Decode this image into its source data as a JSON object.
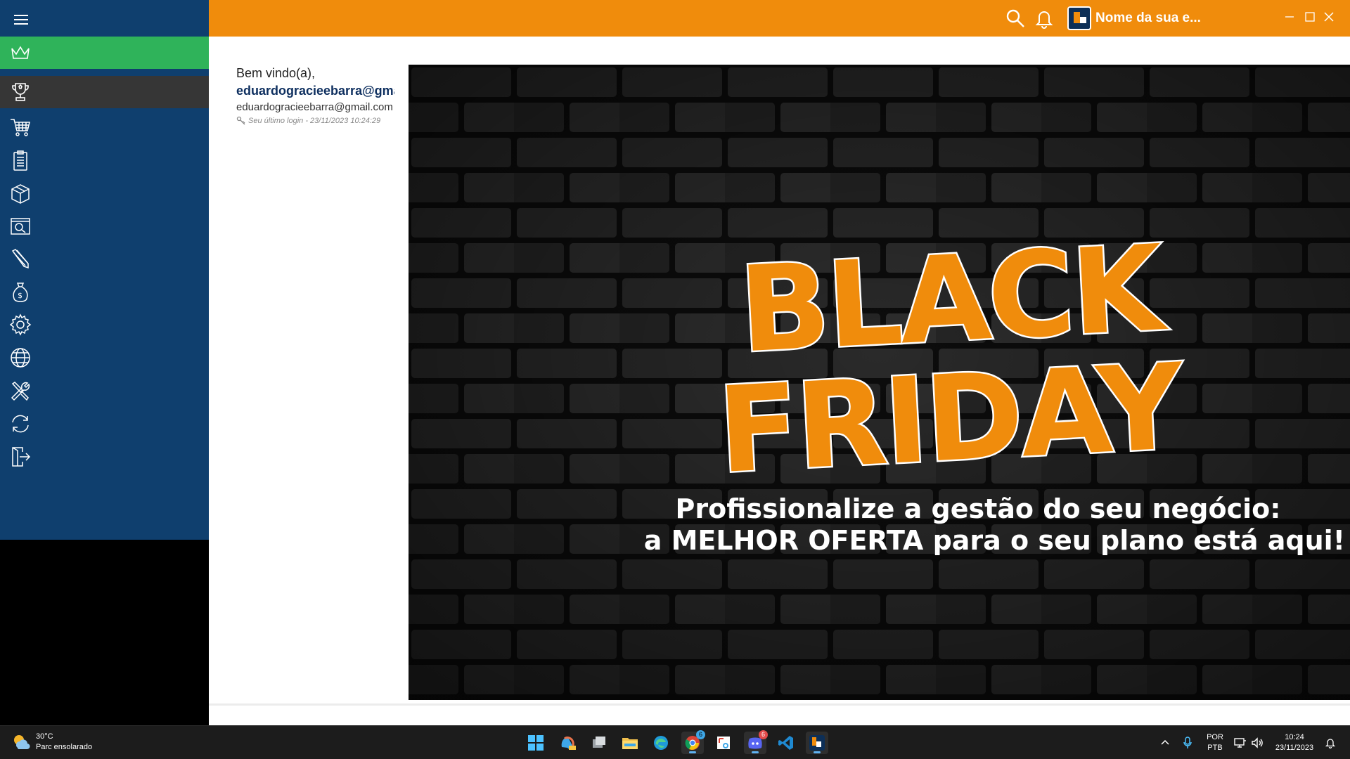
{
  "header": {
    "company_name": "Nome da sua e...",
    "accent_color": "#f08c0c",
    "icons": [
      "search-icon",
      "bell-icon"
    ]
  },
  "sidebar": {
    "color": "#0f3f6e",
    "active_color": "#2fb35a",
    "items": [
      {
        "icon": "crown-icon",
        "state": "active"
      },
      {
        "icon": "trophy-icon",
        "state": "hover"
      },
      {
        "icon": "cart-icon"
      },
      {
        "icon": "clipboard-icon"
      },
      {
        "icon": "box-icon"
      },
      {
        "icon": "screen-search-icon"
      },
      {
        "icon": "pencil-icon"
      },
      {
        "icon": "money-bag-icon"
      },
      {
        "icon": "gear-icon"
      },
      {
        "icon": "globe-icon"
      },
      {
        "icon": "tools-icon"
      },
      {
        "icon": "sync-icon"
      },
      {
        "icon": "logout-icon"
      }
    ]
  },
  "welcome": {
    "greeting": "Bem vindo(a),",
    "username": "eduardogracieebarra@gmai",
    "email": "eduardogracieebarra@gmail.com",
    "last_login": "Seu último login - 23/11/2023 10:24:29"
  },
  "banner": {
    "line1": "BLACK",
    "line2": "FRIDAY",
    "subtitle1": "Profissionalize a gestão do seu negócio:",
    "subtitle2_prefix": "a ",
    "subtitle2_bold": "MELHOR OFERTA",
    "subtitle2_suffix": " para o seu plano está aqui!",
    "text_color": "#f08c0c"
  },
  "taskbar": {
    "weather_temp": "30°C",
    "weather_desc": "Parc ensolarado",
    "lang_top": "POR",
    "lang_bottom": "PTB",
    "time": "10:24",
    "date": "23/11/2023",
    "badges": {
      "chrome": "6",
      "discord": "6"
    }
  }
}
